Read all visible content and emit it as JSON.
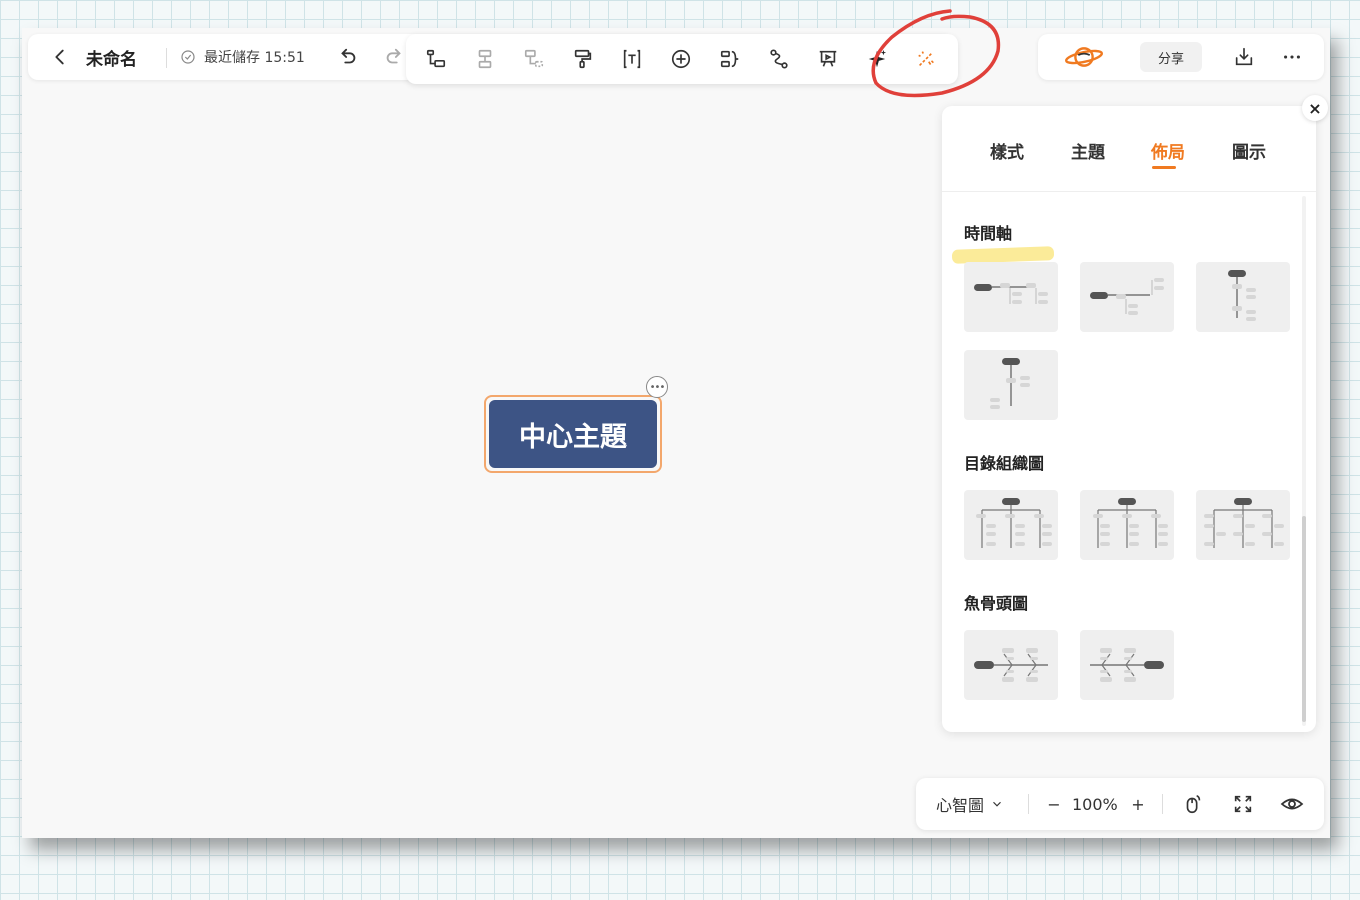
{
  "header": {
    "title": "未命名",
    "saved_status": "最近儲存 15:51",
    "share_label": "分享"
  },
  "toolbar": {
    "tools": [
      "add-child-icon",
      "add-sibling-icon",
      "add-parent-icon",
      "format-painter-icon",
      "text-icon",
      "insert-icon",
      "summary-icon",
      "relation-icon",
      "presentation-icon",
      "ai-sparkle-icon",
      "magic-wand-icon"
    ]
  },
  "canvas": {
    "central_topic": "中心主題"
  },
  "panel": {
    "tabs": [
      {
        "label": "樣式",
        "active": false
      },
      {
        "label": "主題",
        "active": false
      },
      {
        "label": "佈局",
        "active": true
      },
      {
        "label": "圖示",
        "active": false
      }
    ],
    "sections": [
      {
        "title": "時間軸",
        "layout_count": 4
      },
      {
        "title": "目錄組織圖",
        "layout_count": 3
      },
      {
        "title": "魚骨頭圖",
        "layout_count": 2
      }
    ],
    "close_label": "×"
  },
  "bottombar": {
    "view_mode": "心智圖",
    "zoom": "100%",
    "zoom_out": "−",
    "zoom_in": "+"
  },
  "colors": {
    "accent": "#f07a21",
    "topic_fill": "#3d5485",
    "topic_border": "#f3a76c",
    "annotation": "#e0403a",
    "highlight": "#f9e26e"
  }
}
